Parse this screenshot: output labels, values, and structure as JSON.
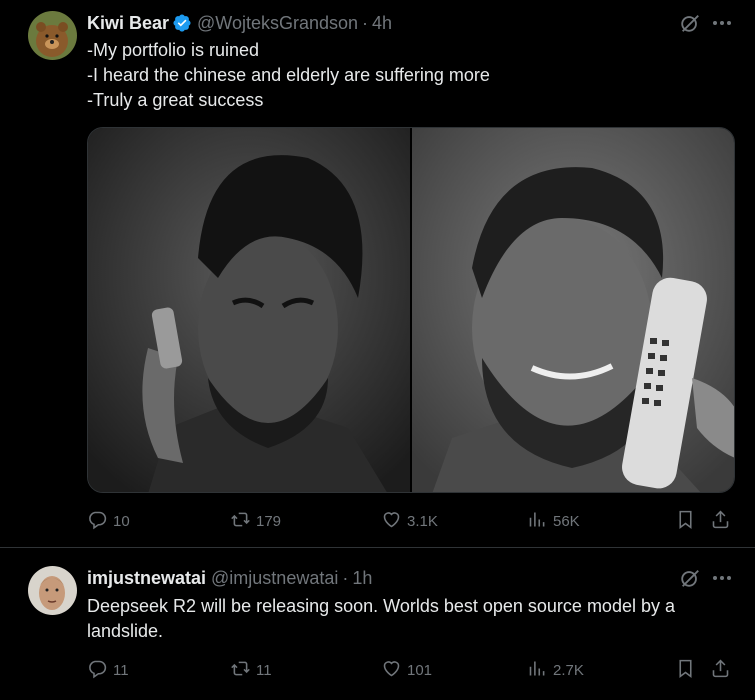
{
  "tweets": [
    {
      "name": "Kiwi Bear",
      "handle": "@WojteksGrandson",
      "separator": "·",
      "time": "4h",
      "lines": [
        "-My portfolio is ruined",
        "-I heard the chinese and elderly are suffering more",
        "-Truly a great success"
      ],
      "verified": true,
      "stats": {
        "replies": "10",
        "reposts": "179",
        "likes": "3.1K",
        "views": "56K"
      }
    },
    {
      "name": "imjustnewatai",
      "handle": "@imjustnewatai",
      "separator": "·",
      "time": "1h",
      "text": "Deepseek R2 will be releasing soon. Worlds best open source model by a landslide.",
      "verified": false,
      "stats": {
        "replies": "11",
        "reposts": "11",
        "likes": "101",
        "views": "2.7K"
      }
    }
  ],
  "colors": {
    "background": "#000000",
    "text": "#e7e9ea",
    "muted": "#71767b",
    "verified": "#1d9bf0",
    "divider": "#2f3336"
  },
  "icons": [
    "grok-icon",
    "more-icon",
    "reply-icon",
    "repost-icon",
    "like-icon",
    "views-icon",
    "bookmark-icon",
    "share-icon",
    "verified-badge-icon"
  ]
}
